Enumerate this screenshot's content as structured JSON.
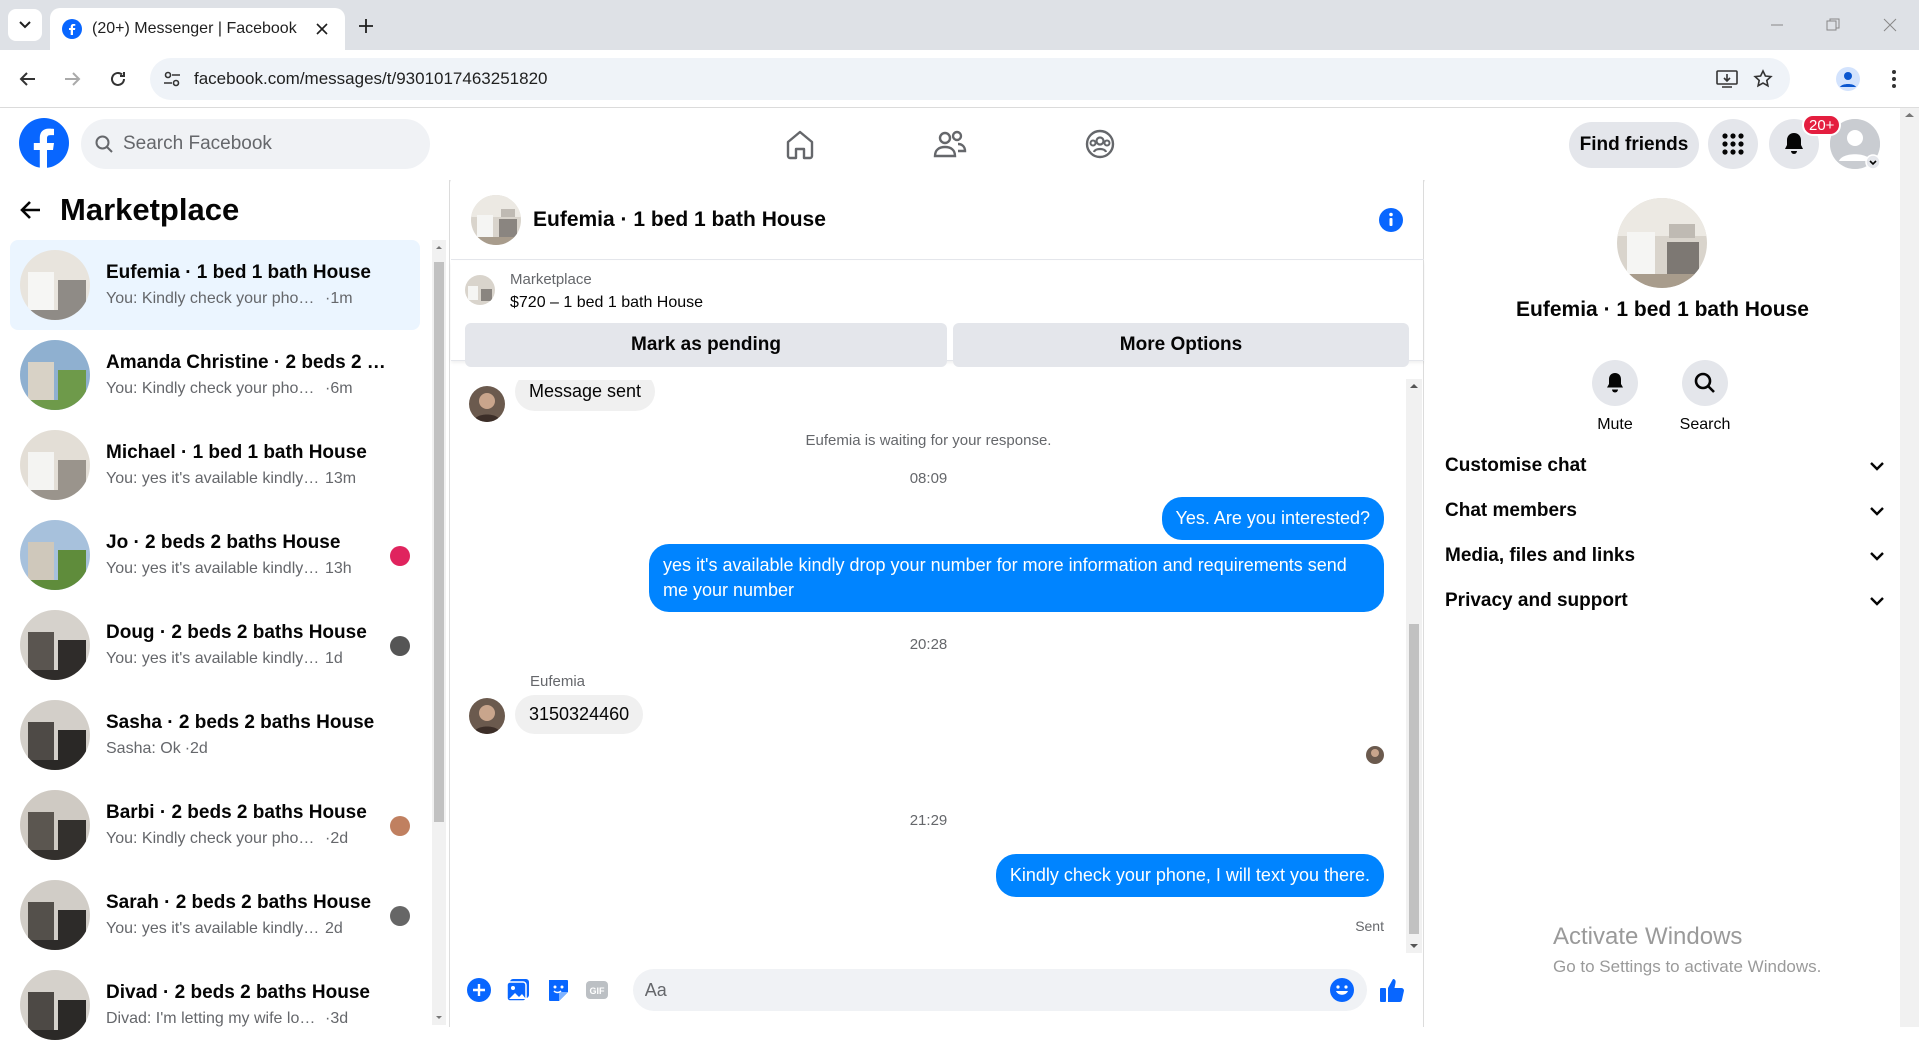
{
  "browser": {
    "tab_title": "(20+) Messenger | Facebook",
    "url": "facebook.com/messages/t/9301017463251820"
  },
  "fb": {
    "search_placeholder": "Search Facebook",
    "find_friends": "Find friends",
    "notif_badge": "20+",
    "accent": "#0866ff"
  },
  "left": {
    "title": "Marketplace",
    "conversations": [
      {
        "name": "Eufemia · 1 bed 1 bath House",
        "preview": "You: Kindly check your phone, I wi...",
        "time": "·1m",
        "active": true
      },
      {
        "name": "Amanda Christine · 2 beds 2 bat...",
        "preview": "You: Kindly check your phone, I wi...",
        "time": "·6m"
      },
      {
        "name": "Michael · 1 bed 1 bath House",
        "preview": "You: yes it's available kindly drop ...",
        "time": "13m"
      },
      {
        "name": "Jo · 2 beds 2 baths House",
        "preview": "You: yes it's available kindly dr...",
        "time": "13h"
      },
      {
        "name": "Doug · 2 beds 2 baths House",
        "preview": "You: yes it's available kindly dro...",
        "time": "1d"
      },
      {
        "name": "Sasha · 2 beds 2 baths House",
        "preview": "Sasha: Ok",
        "time": "·2d"
      },
      {
        "name": "Barbi · 2 beds 2 baths House",
        "preview": "You: Kindly check your phone, I ...",
        "time": "·2d"
      },
      {
        "name": "Sarah · 2 beds 2 baths House",
        "preview": "You: yes it's available kindly dro...",
        "time": "2d"
      },
      {
        "name": "Divad · 2 beds 2 baths House",
        "preview": "Divad: I'm letting my wife look at t...",
        "time": "·3d"
      }
    ]
  },
  "chat": {
    "title": "Eufemia · 1 bed 1 bath House",
    "marketplace_label": "Marketplace",
    "listing": "$720 – 1 bed 1 bath House",
    "mark_pending": "Mark as pending",
    "more_options": "More Options",
    "msg_sent": "Message sent",
    "waiting": "Eufemia is waiting for your response.",
    "time1": "08:09",
    "out1": "Yes. Are you interested?",
    "out2": "yes it's available kindly drop your number for more information and requirements send me your number",
    "time2": "20:28",
    "sender": "Eufemia",
    "in1": "3150324460",
    "time3": "21:29",
    "out3": "Kindly check your phone, I will text you there.",
    "status": "Sent",
    "composer_placeholder": "Aa"
  },
  "right": {
    "name": "Eufemia · 1 bed 1 bath House",
    "mute": "Mute",
    "search": "Search",
    "sections": [
      "Customise chat",
      "Chat members",
      "Media, files and links",
      "Privacy and support"
    ]
  },
  "watermark": {
    "line1": "Activate Windows",
    "line2": "Go to Settings to activate Windows."
  }
}
